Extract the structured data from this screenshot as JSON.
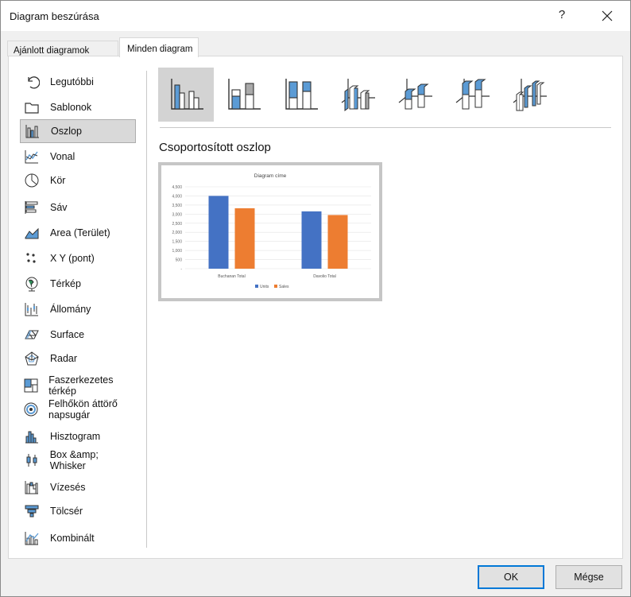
{
  "window": {
    "title": "Diagram beszúrása",
    "help": "?"
  },
  "tabs": [
    {
      "label": "Ajánlott diagramok"
    },
    {
      "label": "Minden diagram"
    }
  ],
  "categories": [
    {
      "label": "Legutóbbi",
      "icon": "recent-icon"
    },
    {
      "label": "Sablonok",
      "icon": "folder-icon"
    },
    {
      "label": "Oszlop",
      "icon": "column-chart-icon",
      "selected": true
    },
    {
      "label": "Vonal",
      "icon": "line-chart-icon"
    },
    {
      "label": "Kör",
      "icon": "pie-chart-icon"
    },
    {
      "label": "Sáv",
      "icon": "bar-chart-icon"
    },
    {
      "label": "Area (Terület)",
      "icon": "area-chart-icon"
    },
    {
      "label": "X Y (pont)",
      "icon": "scatter-chart-icon"
    },
    {
      "label": "Térkép",
      "icon": "map-chart-icon"
    },
    {
      "label": "Állomány",
      "icon": "stock-chart-icon"
    },
    {
      "label": "Surface",
      "icon": "surface-chart-icon"
    },
    {
      "label": "Radar",
      "icon": "radar-chart-icon"
    },
    {
      "label": "Faszerkezetes térkép",
      "icon": "treemap-icon"
    },
    {
      "label": "Felhőkön áttörő napsugár",
      "icon": "sunburst-icon"
    },
    {
      "label": "Hisztogram",
      "icon": "histogram-icon"
    },
    {
      "label": "Box &amp; Whisker",
      "icon": "box-whisker-icon"
    },
    {
      "label": "Vízesés",
      "icon": "waterfall-icon"
    },
    {
      "label": "Tölcsér",
      "icon": "funnel-icon"
    },
    {
      "label": "Kombinált",
      "icon": "combo-chart-icon"
    }
  ],
  "subtypes": [
    {
      "icon": "clustered-column-icon",
      "selected": true
    },
    {
      "icon": "stacked-column-icon"
    },
    {
      "icon": "100-stacked-column-icon"
    },
    {
      "icon": "3d-clustered-column-icon"
    },
    {
      "icon": "3d-stacked-column-icon"
    },
    {
      "icon": "3d-100-stacked-column-icon"
    },
    {
      "icon": "3d-column-icon"
    }
  ],
  "selected_subtype_label": "Csoportosított oszlop",
  "colors": {
    "units": "#4472c4",
    "sales": "#ed7d31",
    "accent": "#0078d7"
  },
  "chart_data": {
    "type": "bar",
    "title": "Diagram címe",
    "categories": [
      "Buchanan Total",
      "Davolio Total"
    ],
    "series": [
      {
        "name": "Units",
        "values": [
          4000,
          3150
        ]
      },
      {
        "name": "Sales",
        "values": [
          3320,
          2950
        ]
      }
    ],
    "yticks": [
      "4,500",
      "4,000",
      "3,500",
      "3,000",
      "2,500",
      "2,000",
      "1,500",
      "1,000",
      "500",
      "-"
    ],
    "ylim": [
      0,
      4500
    ],
    "grid": true,
    "legend": "bottom"
  },
  "buttons": {
    "ok": "OK",
    "cancel": "Mégse"
  }
}
